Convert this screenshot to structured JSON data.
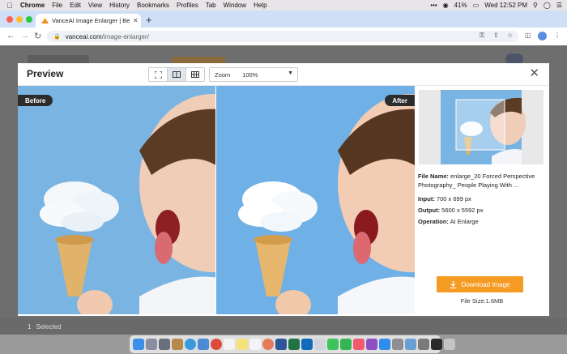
{
  "menubar": {
    "app": "Chrome",
    "items": [
      "File",
      "Edit",
      "View",
      "History",
      "Bookmarks",
      "Profiles",
      "Tab",
      "Window",
      "Help"
    ],
    "battery": "41%",
    "clock": "Wed 12:52 PM"
  },
  "browser": {
    "tab_title": "VanceAI Image Enlarger | Best",
    "url_host": "vanceai.com",
    "url_path": "/image-enlarger/"
  },
  "page": {
    "selected_count": "1",
    "selected_label": "Selected"
  },
  "modal": {
    "title": "Preview",
    "zoom_label": "Zoom",
    "zoom_value": "100%",
    "before_label": "Before",
    "after_label": "After",
    "file_name_label": "File Name:",
    "file_name_value": "enlarge_20 Forced Perspective Photography_ People Playing With ...",
    "input_label": "Input:",
    "input_value": "700 x 699 px",
    "output_label": "Output:",
    "output_value": "5600 x 5592 px",
    "operation_label": "Operation:",
    "operation_value": "AI Enlarge",
    "download_label": "Download Image",
    "file_size_label": "File Size:",
    "file_size_value": "1.6MB"
  },
  "colors": {
    "accent": "#f59a23",
    "chip": "#2c2c2c",
    "sky": "#79b5e4"
  },
  "dock_apps": [
    "finder",
    "launchpad",
    "rocket",
    "safari",
    "mail",
    "chrome",
    "calendar",
    "notes",
    "reminders",
    "photos",
    "word",
    "excel",
    "outlook",
    "messages",
    "facetime",
    "music",
    "podcasts",
    "appstore",
    "settings",
    "preview",
    "finder-window",
    "terminal",
    "trash"
  ]
}
